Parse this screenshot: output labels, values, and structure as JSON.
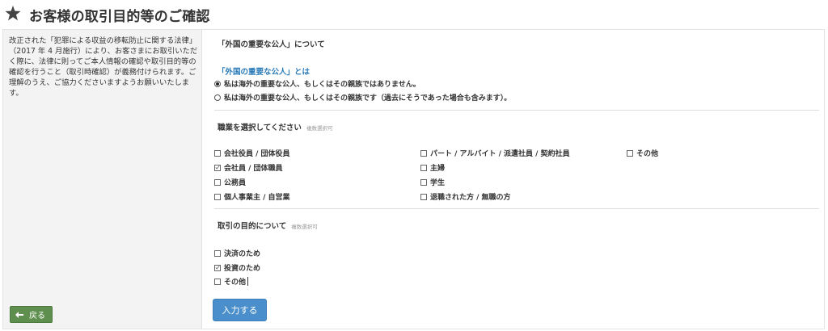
{
  "header": {
    "title": "お客様の取引目的等のご確認",
    "icon": "star-icon"
  },
  "notice": {
    "text": "改正された「犯罪による収益の移転防止に関する法律」（2017 年 4 月施行）により、お客さまにお取引いただく際に、法律に則ってご本人情報の確認や取引目的等の確認を行うこと（取引時確認）が義務付けられます。ご理解のうえ、ご協力くださいますようお願いいたします。"
  },
  "pep": {
    "title": "「外国の重要な公人」について",
    "subheading": "「外国の重要な公人」とは",
    "options": [
      {
        "label": "私は海外の重要な公人、もしくはその親族ではありません。",
        "selected": true
      },
      {
        "label": "私は海外の重要な公人、もしくはその親族です（過去にそうであった場合も含みます）。",
        "selected": false
      }
    ]
  },
  "occupation": {
    "title": "職業を選択してください",
    "note": "複数選択可",
    "options": [
      {
        "label": "会社役員 / 団体役員",
        "checked": false
      },
      {
        "label": "パート / アルバイト / 派遣社員 / 契約社員",
        "checked": false
      },
      {
        "label": "その他",
        "checked": false
      },
      {
        "label": "会社員 / 団体職員",
        "checked": true
      },
      {
        "label": "主婦",
        "checked": false
      },
      {
        "label": "公務員",
        "checked": false
      },
      {
        "label": "学生",
        "checked": false
      },
      {
        "label": "個人事業主 / 自営業",
        "checked": false
      },
      {
        "label": "退職された方 / 無職の方",
        "checked": false
      }
    ]
  },
  "purpose": {
    "title": "取引の目的について",
    "note": "複数選択可",
    "options": [
      {
        "label": "決済のため",
        "checked": false
      },
      {
        "label": "投資のため",
        "checked": true
      },
      {
        "label": "その他",
        "checked": false
      }
    ]
  },
  "buttons": {
    "submit_label": "入力する",
    "back_label": "戻る"
  },
  "colors": {
    "link_blue": "#2a7ab8",
    "submit_blue": "#4a8fcc",
    "back_green": "#5f8f4e"
  }
}
